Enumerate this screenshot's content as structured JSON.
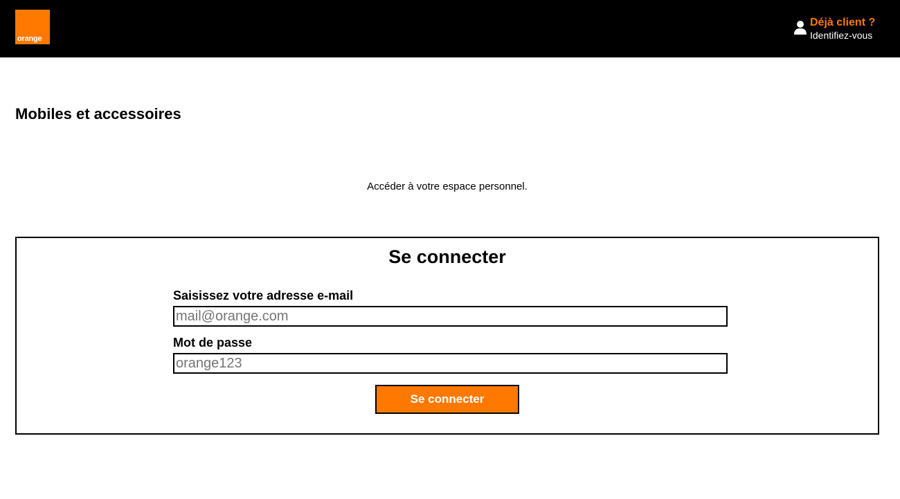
{
  "header": {
    "logo_text": "orange",
    "account_title": "Déjà client ?",
    "account_subtitle": "Identifiez-vous"
  },
  "page": {
    "title": "Mobiles et accessoires",
    "intro": "Accéder à votre espace personnel."
  },
  "login": {
    "title": "Se connecter",
    "email_label": "Saisissez votre adresse e-mail",
    "email_placeholder": "mail@orange.com",
    "password_label": "Mot de passe",
    "password_placeholder": "orange123",
    "submit_label": "Se connecter"
  },
  "colors": {
    "brand": "#ff7900",
    "header_bg": "#000000"
  },
  "icons": {
    "account": "user-icon"
  }
}
